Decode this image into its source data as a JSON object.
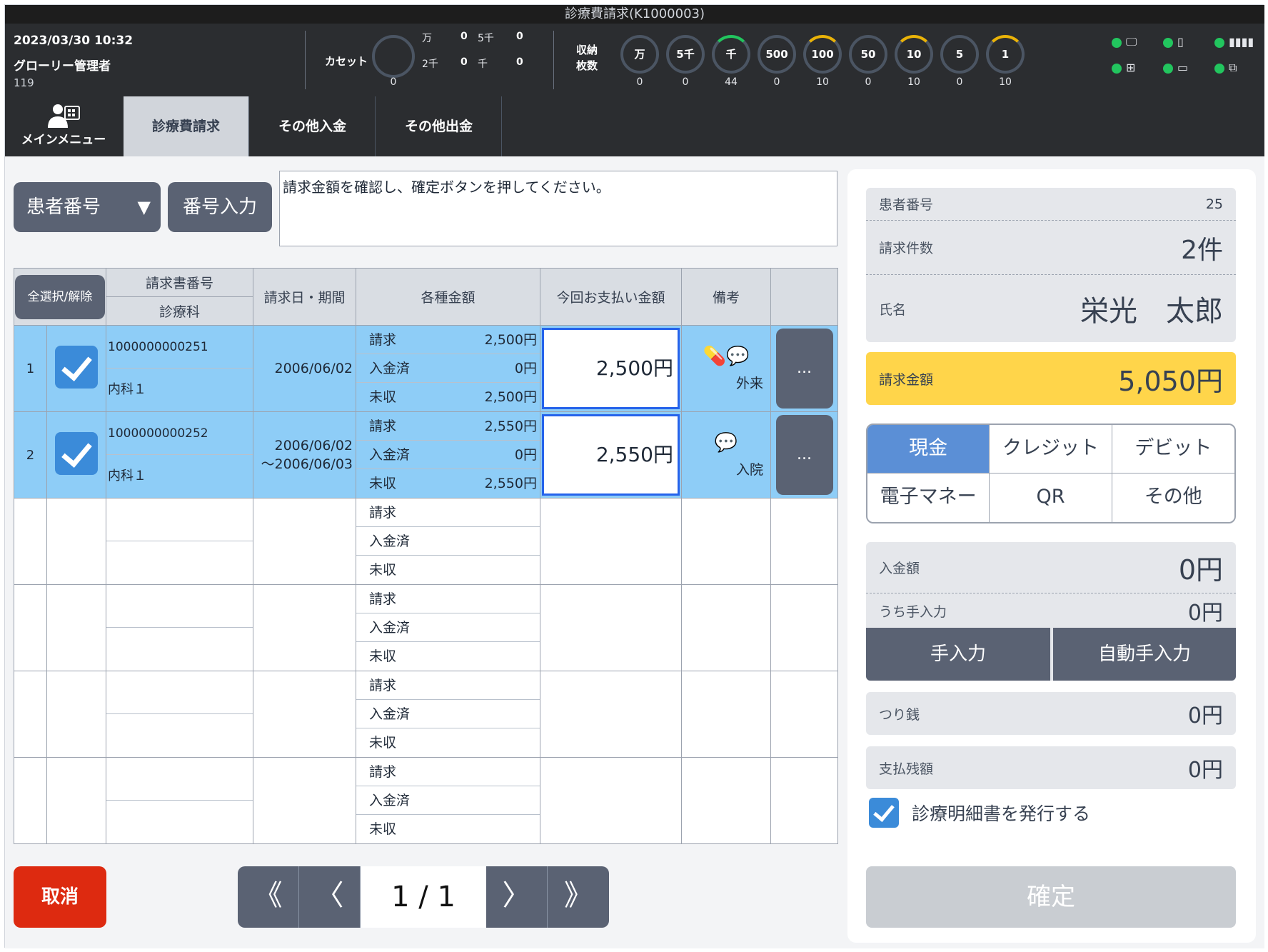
{
  "window": {
    "title": "診療費請求(K1000003)"
  },
  "header": {
    "datetime": "2023/03/30 10:32",
    "user": "グローリー管理者",
    "terminal_id": "119",
    "cassette": {
      "label": "カセット",
      "count": "0",
      "cells": [
        {
          "label": "万",
          "value": "0"
        },
        {
          "label": "5千",
          "value": "0"
        },
        {
          "label": "2千",
          "value": "0"
        },
        {
          "label": "千",
          "value": "0"
        }
      ]
    },
    "storage": {
      "label_line1": "収納",
      "label_line2": "枚数",
      "denominations": [
        {
          "label": "万",
          "count": "0",
          "level": "empty"
        },
        {
          "label": "5千",
          "count": "0",
          "level": "empty"
        },
        {
          "label": "千",
          "count": "44",
          "level": "green"
        },
        {
          "label": "500",
          "count": "0",
          "level": "empty"
        },
        {
          "label": "100",
          "count": "10",
          "level": "yellow"
        },
        {
          "label": "50",
          "count": "0",
          "level": "empty"
        },
        {
          "label": "10",
          "count": "10",
          "level": "yellow"
        },
        {
          "label": "5",
          "count": "0",
          "level": "empty"
        },
        {
          "label": "1",
          "count": "10",
          "level": "yellow"
        }
      ]
    },
    "devices": [
      {
        "icon": "monitor-icon",
        "glyph": "🖵"
      },
      {
        "icon": "device-icon",
        "glyph": "▯"
      },
      {
        "icon": "barcode-icon",
        "glyph": "▮▮▮▮"
      },
      {
        "icon": "network-icon",
        "glyph": "⊞"
      },
      {
        "icon": "card-reader-icon",
        "glyph": "▭"
      },
      {
        "icon": "payment-terminal-icon",
        "glyph": "⧉"
      }
    ],
    "status_color": "#22c55e"
  },
  "nav": {
    "main_menu": "メインメニュー",
    "tabs": [
      {
        "label": "診療費請求",
        "active": true
      },
      {
        "label": "その他入金",
        "active": false
      },
      {
        "label": "その他出金",
        "active": false
      }
    ]
  },
  "search": {
    "select_label": "患者番号",
    "number_input_label": "番号入力",
    "message": "請求金額を確認し、確定ボタンを押してください。"
  },
  "table": {
    "select_all": "全選択/解除",
    "headers": {
      "invoice_no": "請求書番号",
      "department": "診療科",
      "date": "請求日・期間",
      "amounts": "各種金額",
      "payment": "今回お支払い金額",
      "note": "備考"
    },
    "amount_labels": [
      "請求",
      "入金済",
      "未収"
    ],
    "rows": [
      {
        "no": "1",
        "invoice_no": "1000000000251",
        "department": "内科１",
        "date_line1": "2006/06/02",
        "date_line2": "",
        "billed": "2,500円",
        "paid": "0円",
        "unpaid": "2,500円",
        "payment": "2,500円",
        "note_icons": "💊💬",
        "note": "外来",
        "more": "..."
      },
      {
        "no": "2",
        "invoice_no": "1000000000252",
        "department": "内科１",
        "date_line1": "2006/06/02",
        "date_line2": "～2006/06/03",
        "billed": "2,550円",
        "paid": "0円",
        "unpaid": "2,550円",
        "payment": "2,550円",
        "note_icons": "💬",
        "note": "入院",
        "more": "..."
      }
    ],
    "empty_rows": 4,
    "selected_color": "#8ecdf7"
  },
  "footer": {
    "cancel": "取消",
    "pager": {
      "first": "《",
      "prev": "〈",
      "display": "1 / 1",
      "next": "〉",
      "last": "》"
    }
  },
  "summary": {
    "patient_no_label": "患者番号",
    "patient_no": "25",
    "count_label": "請求件数",
    "count": "2件",
    "name_label": "氏名",
    "name": "栄光　太郎",
    "billed_label": "請求金額",
    "billed": "5,050円",
    "methods": [
      "現金",
      "クレジット",
      "デビット",
      "電子マネー",
      "QR",
      "その他"
    ],
    "active_method": "現金",
    "received_label": "入金額",
    "received": "0円",
    "manual_part_label": "うち手入力",
    "manual_part": "0円",
    "manual_input": "手入力",
    "auto_manual_input": "自動手入力",
    "change_label": "つり銭",
    "change": "0円",
    "remaining_label": "支払残額",
    "remaining": "0円",
    "statement_checkbox": "診療明細書を発行する",
    "confirm": "確定",
    "billed_color": "#ffd54a",
    "active_method_color": "#5b8fd6"
  }
}
